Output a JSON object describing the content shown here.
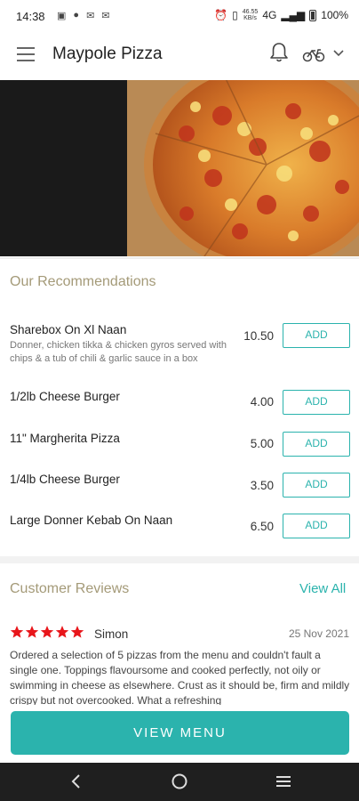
{
  "status_bar": {
    "time": "14:38",
    "network": "4G",
    "battery": "100%"
  },
  "app_bar": {
    "title": "Maypole Pizza"
  },
  "recommendations": {
    "title": "Our Recommendations",
    "items": [
      {
        "name": "Sharebox On Xl Naan",
        "description": "Donner, chicken tikka & chicken gyros served with chips & a tub of chili & garlic sauce in a box",
        "price": "10.50",
        "button": "ADD"
      },
      {
        "name": "1/2lb Cheese Burger",
        "description": "",
        "price": "4.00",
        "button": "ADD"
      },
      {
        "name": "11\" Margherita Pizza",
        "description": "",
        "price": "5.00",
        "button": "ADD"
      },
      {
        "name": "1/4lb Cheese Burger",
        "description": "",
        "price": "3.50",
        "button": "ADD"
      },
      {
        "name": "Large Donner Kebab On Naan",
        "description": "",
        "price": "6.50",
        "button": "ADD"
      }
    ]
  },
  "reviews": {
    "title": "Customer Reviews",
    "view_all": "View All",
    "items": [
      {
        "rating": 5,
        "name": "Simon",
        "date": "25 Nov 2021",
        "text": "Ordered a selection of 5 pizzas from the menu and couldn't fault a single one.  Toppings flavoursome and cooked perfectly, not oily or swimming in cheese as elsewhere.  Crust as it should be, firm and mildly crispy but not overcooked.  What a refreshing"
      }
    ]
  },
  "cta": {
    "view_menu": "VIEW MENU"
  },
  "colors": {
    "accent": "#2bb3ad",
    "section_title": "#a49a78",
    "star": "#e8161b"
  }
}
